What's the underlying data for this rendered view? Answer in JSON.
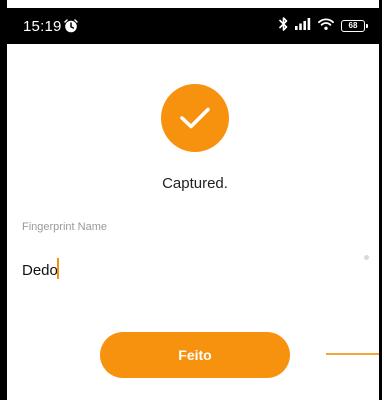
{
  "status_bar": {
    "time": "15:19",
    "battery": "68",
    "icons": [
      "alarm-icon",
      "bluetooth-icon",
      "signal-icon",
      "wifi-icon",
      "battery-icon"
    ]
  },
  "main": {
    "status_message": "Captured.",
    "status_icon": "checkmark-icon",
    "field_label": "Fingerprint Name",
    "field_value": "Dedo",
    "done_label": "Feito"
  },
  "colors": {
    "accent": "#f7920e",
    "status_bar_bg": "#000000",
    "label_gray": "#9a9a9a"
  }
}
